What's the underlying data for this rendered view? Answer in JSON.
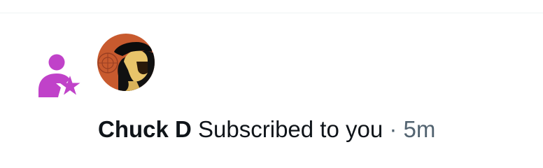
{
  "notification": {
    "type_icon": "person-star-icon",
    "avatar_icon": "user-avatar",
    "user_name": "Chuck D",
    "action_text": "Subscribed to you",
    "separator": "·",
    "time": "5m",
    "accent_color": "#c042c9"
  }
}
